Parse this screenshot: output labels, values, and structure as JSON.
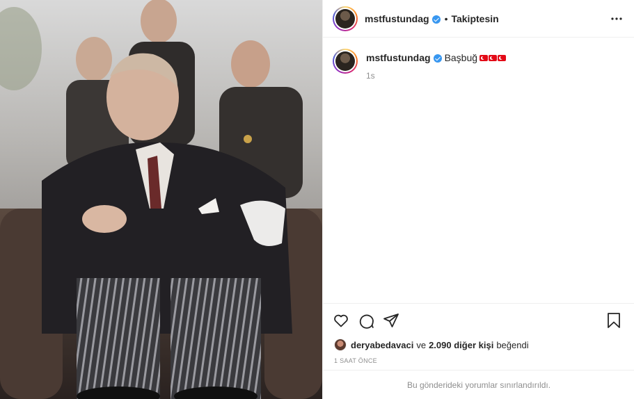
{
  "header": {
    "username": "mstfustundag",
    "separator": "•",
    "follow_status": "Takiptesin",
    "icons": {
      "verified": "verified-badge-icon",
      "more": "more-options-icon"
    }
  },
  "caption": {
    "username": "mstfustundag",
    "text": "Başbuğ",
    "emoji": "turkish-flag-emoji",
    "emoji_count": 3,
    "time": "1s"
  },
  "actions": {
    "icons": [
      "heart-icon",
      "comment-icon",
      "share-icon",
      "bookmark-icon"
    ]
  },
  "likes": {
    "liker": "deryabedavaci",
    "connector": "ve",
    "others": "2.090 diğer kişi",
    "verb": "beğendi"
  },
  "time_ago": "1 SAAT ÖNCE",
  "comments_notice": "Bu gönderideki yorumlar sınırlandırıldı.",
  "colors": {
    "verified": "#3897f0",
    "text": "#262626",
    "muted": "#8e8e8e",
    "divider": "#efefef",
    "flag_red": "#e30a17"
  }
}
